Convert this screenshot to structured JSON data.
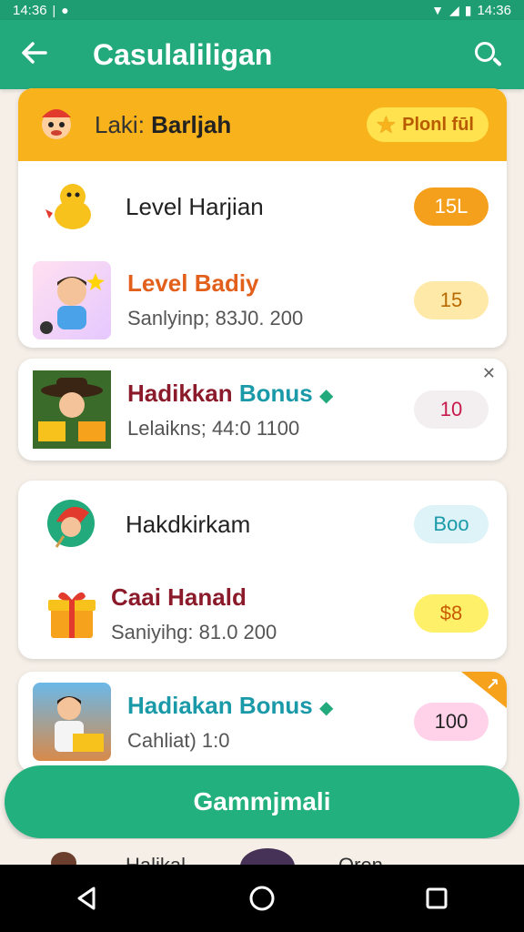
{
  "status_bar": {
    "time": "14:36",
    "right_text": "14:36"
  },
  "app_bar": {
    "title": "Casulaliligan",
    "back_icon": "arrow-left-icon",
    "search_icon": "search-icon"
  },
  "card1": {
    "header": {
      "title_prefix": "Laki:",
      "title_bold": "Barljah",
      "button_label": "Plonl fūl"
    },
    "rows": [
      {
        "title": "Level Harjian",
        "badge": "15L"
      },
      {
        "title": "Level Badiy",
        "subtitle": "Sanlyinp; 83J0. 200",
        "badge": "15"
      }
    ]
  },
  "card2": {
    "title_part1": "Hadikkan",
    "title_part2": "Bonus",
    "subtitle": "Lelaikns; 44:0 1100",
    "badge": "10"
  },
  "card3": {
    "rows": [
      {
        "title": "Hakdkirkam",
        "badge": "Boo"
      },
      {
        "title": "Caai Hanald",
        "subtitle": "Saniyihg: 81.0 200",
        "badge": "$8"
      }
    ]
  },
  "card4": {
    "title": "Hadiakan Bonus",
    "subtitle": "Cahliat) 1:0",
    "badge": "100"
  },
  "cta": {
    "label": "Gammjmali"
  },
  "peek": {
    "left_text": "Halikal",
    "right_text": "Oren"
  },
  "colors": {
    "primary": "#22a97c",
    "header_orange": "#f7b21c",
    "badge_orange": "#f5a01c"
  }
}
